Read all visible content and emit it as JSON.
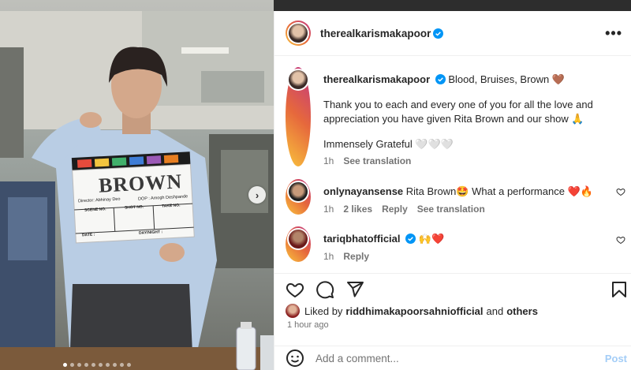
{
  "post": {
    "username": "therealkarismakapoor",
    "more_label": "•••",
    "caption": {
      "username": "therealkarismakapoor",
      "first_line": "Blood, Bruises, Brown 🤎",
      "paragraph": "Thank you to each and every one of you for all the love and appreciation you have given Rita Brown and our show 🙏",
      "closing": "Immensely Grateful",
      "closing_emoji": "🤍🤍🤍",
      "time": "1h",
      "see_translation": "See translation"
    },
    "comments": [
      {
        "username": "onlynayansense",
        "text": "Rita Brown🤩 What a performance ❤️🔥",
        "time": "1h",
        "likes": "2 likes",
        "reply": "Reply",
        "see_translation": "See translation"
      },
      {
        "username": "tariqbhatofficial",
        "text": "🙌❤️",
        "time": "1h",
        "reply": "Reply"
      }
    ],
    "liked_by_prefix": "Liked by",
    "liked_by_user": "riddhimakapoorsahniofficial",
    "liked_by_and": "and",
    "liked_by_others": "others",
    "timestamp": "1 hour ago",
    "comment_placeholder": "Add a comment...",
    "post_button": "Post"
  },
  "photo": {
    "clapper_title": "BROWN",
    "director": "Director: Abhinay Deo",
    "dop": "DOP : Amogh Deshpande",
    "scene_label": "SCENE NO.",
    "shot_label": "SHOT NO.",
    "take_label": "TAKE NO.",
    "date_label": "DATE :",
    "daynight_label": "DAY/NIGHT :",
    "carousel_count": 10,
    "carousel_active": 0
  },
  "colors": {
    "verified": "#0095f6",
    "heart": "#ed4956",
    "post_disabled": "#a3cdf7",
    "secondary_text": "#737373"
  }
}
